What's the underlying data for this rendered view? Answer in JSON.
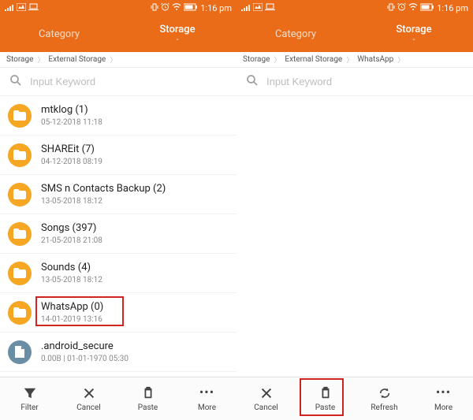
{
  "status": {
    "time": "1:16 pm"
  },
  "header": {
    "tab_category": "Category",
    "tab_storage": "Storage",
    "tab_storage_sub": "-"
  },
  "search": {
    "placeholder": "Input Keyword"
  },
  "left": {
    "crumbs": [
      "Storage",
      "External Storage"
    ],
    "items": [
      {
        "name": "mtklog (1)",
        "meta": "05-12-2018 11:18",
        "type": "folder"
      },
      {
        "name": "SHAREit (7)",
        "meta": "04-12-2018 08:19",
        "type": "folder"
      },
      {
        "name": "SMS n Contacts Backup (2)",
        "meta": "13-05-2018 18:12",
        "type": "folder"
      },
      {
        "name": "Songs (397)",
        "meta": "21-05-2018 21:08",
        "type": "folder"
      },
      {
        "name": "Sounds (4)",
        "meta": "13-05-2018 18:12",
        "type": "folder"
      },
      {
        "name": "WhatsApp (0)",
        "meta": "14-01-2019 13:16",
        "type": "folder"
      },
      {
        "name": ".android_secure",
        "meta": "0.00B | 01-01-1970 05:30",
        "type": "file"
      }
    ]
  },
  "right": {
    "crumbs": [
      "Storage",
      "External Storage",
      "WhatsApp"
    ]
  },
  "bottom": {
    "filter": "Filter",
    "cancel": "Cancel",
    "paste": "Paste",
    "more": "More",
    "refresh": "Refresh"
  }
}
